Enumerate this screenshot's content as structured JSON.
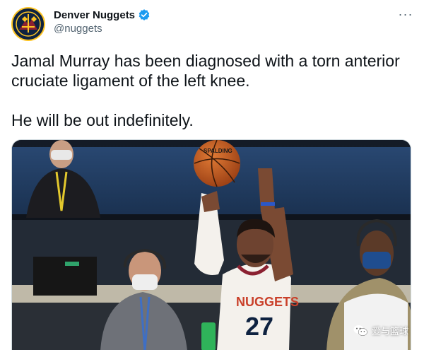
{
  "account": {
    "display_name": "Denver Nuggets",
    "handle": "@nuggets",
    "verified": true,
    "avatar_icon": "nuggets-logo-icon"
  },
  "more_label": "···",
  "tweet": {
    "paragraph_1": "Jamal Murray has been diagnosed with a torn anterior cruciate ligament of the left knee.",
    "paragraph_2": "He will be out indefinitely."
  },
  "media": {
    "jersey_text": "NUGGETS",
    "jersey_number": "27",
    "ball_text": "SPALDING"
  },
  "watermark": {
    "text": "爱与篮球",
    "icon": "wechat-icon"
  },
  "colors": {
    "verified_blue": "#1d9bf0",
    "nuggets_navy": "#0e2240",
    "nuggets_gold": "#fec524"
  }
}
